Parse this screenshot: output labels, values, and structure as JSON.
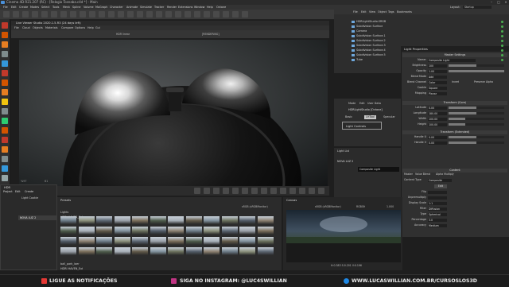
{
  "window": {
    "title": "Cinema 4D R21.207 (RC) - [Relogio Tosnaba.c4d *] - Main"
  },
  "menu": [
    "File",
    "Edit",
    "Create",
    "Modes",
    "Select",
    "Tools",
    "Mesh",
    "Spline",
    "Volume",
    "MoGraph",
    "Character",
    "Animate",
    "Simulate",
    "Tracker",
    "Render",
    "Extensions",
    "Window",
    "Help",
    "Octane"
  ],
  "layout_label": "Layout:",
  "layout_value": "Startup",
  "viewer": {
    "title": "Live Viewer Studio 2020.1.5-R3 (24 days left)",
    "menu": [
      "File",
      "Cloud",
      "Objects",
      "Materials",
      "Compare",
      "Options",
      "Help",
      "Gui"
    ],
    "hdr_label": "HDR linear",
    "toolbar_extra": "[RENDERING]",
    "status_left": "%97",
    "status_left2": "61",
    "status_stat": "0/4Gb"
  },
  "object_tabs": [
    "File",
    "Edit",
    "View",
    "Object",
    "Tags",
    "Bookmarks"
  ],
  "objects": [
    "HDRLightStudio.SRGB",
    "Subdivision Surface",
    "Camera",
    "Subdivision Surface.1",
    "Subdivision Surface.2",
    "Subdivision Surface.3",
    "Subdivision Surface.4",
    "Subdivision Surface.5",
    "Tube"
  ],
  "attr": {
    "tabs": [
      "Mode",
      "Edit",
      "User Data"
    ],
    "title": "HDRLightStudio [Octane]",
    "subtabs": [
      "Basic",
      "LHTool",
      "Specular"
    ],
    "light_controls": "Light Controls",
    "light_list_title": "Light List",
    "light_item": "NOVA LUZ 2",
    "light_item_highlight": "Composite Light"
  },
  "light_props": {
    "title": "Light Properties",
    "section_master": "Master Settings",
    "name_label": "Name:",
    "name_value": "Composite Light",
    "rows": [
      {
        "label": "Brightness",
        "value": "100",
        "fill": 0.5
      },
      {
        "label": "Opacity",
        "value": "1.00",
        "fill": 1.0
      },
      {
        "label": "Blend Mode",
        "value": "Add",
        "fill": 0
      },
      {
        "label": "Blend Channel",
        "value": "Color",
        "fill": 0
      },
      {
        "label": "Cookie",
        "value": "Square",
        "fill": 0
      },
      {
        "label": "Mapping",
        "value": "Planar",
        "fill": 0
      }
    ],
    "invert_label": "Invert",
    "preserve_alpha_label": "Preserve Alpha",
    "section_transform": "Transform (Core)",
    "transform_rows": [
      {
        "label": "Latitude",
        "value": "0.00",
        "fill": 0.5
      },
      {
        "label": "Longitude",
        "value": "180.00",
        "fill": 0.5
      },
      {
        "label": "Width",
        "value": "100.00",
        "fill": 0.3
      },
      {
        "label": "Height",
        "value": "100.00",
        "fill": 0.3
      }
    ],
    "section_transform_ext": "Transform (Extended)",
    "ext_rows": [
      {
        "label": "Handle U",
        "value": "0.00",
        "fill": 0.5
      },
      {
        "label": "Handle V",
        "value": "0.00",
        "fill": 0.5
      }
    ],
    "section_content": "Content",
    "content_tabs": [
      "Master",
      "Value Blend",
      "Alpha Multiply"
    ],
    "content_type_label": "Content Type",
    "content_type_value": "Composite",
    "edit_button": "Edit",
    "content_rows": [
      {
        "label": "Flip",
        "value": ""
      },
      {
        "label": "Unpremultiply",
        "value": ""
      },
      {
        "label": "Display Scale",
        "value": "1:1"
      },
      {
        "label": "Filter",
        "value": "Diffusion"
      },
      {
        "label": "Type",
        "value": "Spherical"
      },
      {
        "label": "Percentage",
        "value": "3.0"
      },
      {
        "label": "Accuracy",
        "value": "Medium"
      }
    ]
  },
  "hdr_panel": {
    "title": "HDR",
    "menu": [
      "Project",
      "Edit",
      "Create"
    ],
    "list_title": "Light Cookie",
    "item": "NOVA LUZ 2"
  },
  "presets": {
    "title": "Presets",
    "tab": "Lights",
    "breadcrumb": "HDRI HAVEN_Ext",
    "footer": "ball_park_laer",
    "footer2": "HDRI HAVEN_Ext",
    "color_space": "sRGB (sRGBMonitor)",
    "value": "1.000",
    "rows": 4,
    "cols": 12
  },
  "canvas_panel": {
    "title": "Canvas",
    "color_space": "sRGB (sRGBMonitor)",
    "mode": "RGBOK",
    "value": "1.000",
    "status": "H:0.383 S:0.201 V:0.196"
  },
  "footer": {
    "item1": "LIGUE AS NOTIFICAÇÕES",
    "item2": "SIGA NO INSTAGRAM: @LUC4SWILLIAN",
    "item3": "WWW.LUCASWILLIAN.COM.BR/CURSOSLOS3D",
    "colors": {
      "bell": "#e53935",
      "insta": "#c13584",
      "web": "#1e88e5"
    }
  },
  "icons": [
    "bell-icon",
    "instagram-icon",
    "globe-icon",
    "close-icon",
    "minimize-icon",
    "maximize-icon"
  ]
}
